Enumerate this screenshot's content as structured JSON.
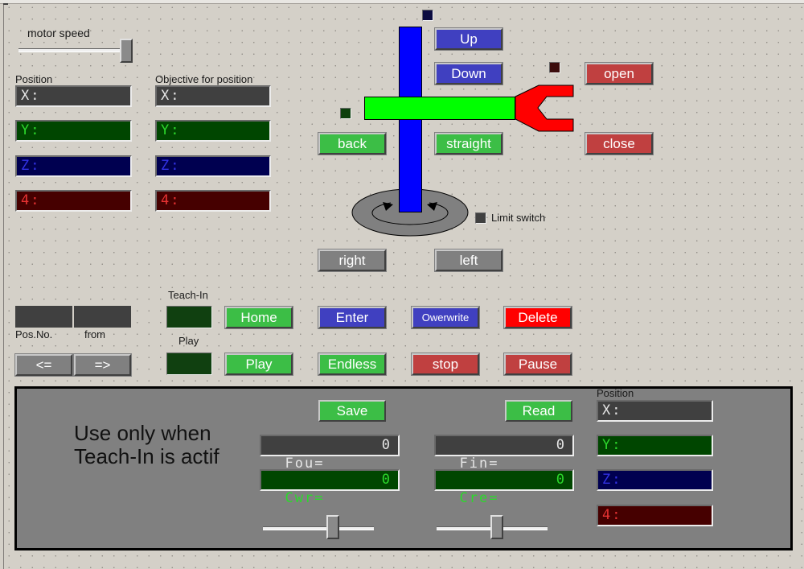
{
  "motor_speed": {
    "label": "motor speed",
    "value_percent": 100
  },
  "position": {
    "label": "Position",
    "x": "X:",
    "y": "Y:",
    "z": "Z:",
    "r": "4:"
  },
  "objective": {
    "label": "Objective for position",
    "x": "X:",
    "y": "Y:",
    "z": "Z:",
    "r": "4:"
  },
  "axis_buttons": {
    "up": "Up",
    "down": "Down",
    "back": "back",
    "straight": "straight",
    "open": "open",
    "close": "close",
    "right": "right",
    "left": "left"
  },
  "limit_switch": {
    "label": "Limit switch"
  },
  "program": {
    "pos_no_label": "Pos.No.",
    "from_label": "from",
    "prev": "<=",
    "next": "=>",
    "teach_in_label": "Teach-In",
    "play_label": "Play",
    "home": "Home",
    "play": "Play",
    "enter": "Enter",
    "overwrite": "Owerwrite",
    "delete": "Delete",
    "endless": "Endless",
    "stop": "stop",
    "pause": "Pause"
  },
  "teach_panel": {
    "note_line1": "Use only when",
    "note_line2": "Teach-In is actif",
    "save": "Save",
    "read": "Read",
    "fou_label": "Fou=",
    "fou_value": "0",
    "cwr_label": "Cwr=",
    "cwr_value": "0",
    "fin_label": "Fin=",
    "fin_value": "0",
    "cre_label": "Cre=",
    "cre_value": "0",
    "slider1_value_percent": 65,
    "slider2_value_percent": 55,
    "position_label": "Position",
    "x": "X:",
    "y": "Y:",
    "z": "Z:",
    "r": "4:"
  },
  "colors": {
    "z_axis": "#0000ff",
    "arm": "#00ff00",
    "gripper": "#ff0000",
    "base": "#808080",
    "background": "#d4d0c8"
  }
}
